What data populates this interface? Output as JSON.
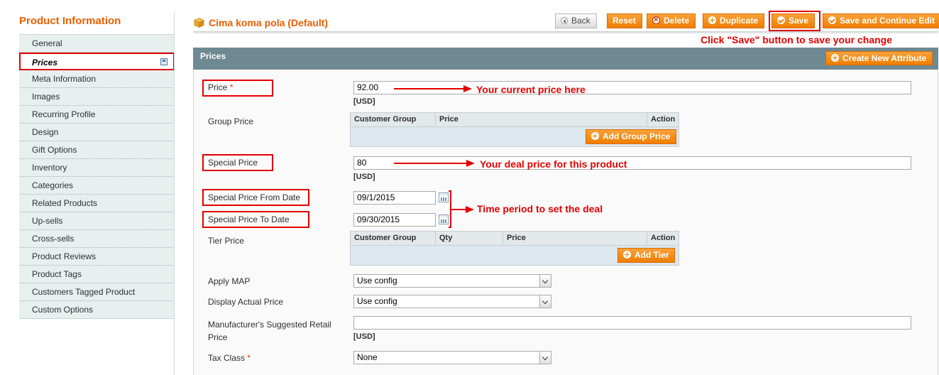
{
  "sidebar": {
    "title": "Product Information",
    "items": [
      {
        "label": "General"
      },
      {
        "label": "Prices"
      },
      {
        "label": "Meta Information"
      },
      {
        "label": "Images"
      },
      {
        "label": "Recurring Profile"
      },
      {
        "label": "Design"
      },
      {
        "label": "Gift Options"
      },
      {
        "label": "Inventory"
      },
      {
        "label": "Categories"
      },
      {
        "label": "Related Products"
      },
      {
        "label": "Up-sells"
      },
      {
        "label": "Cross-sells"
      },
      {
        "label": "Product Reviews"
      },
      {
        "label": "Product Tags"
      },
      {
        "label": "Customers Tagged Product"
      },
      {
        "label": "Custom Options"
      }
    ]
  },
  "header": {
    "title": "Cima koma pola (Default)",
    "buttons": {
      "back": "Back",
      "reset": "Reset",
      "delete": "Delete",
      "duplicate": "Duplicate",
      "save": "Save",
      "save_continue": "Save and Continue Edit"
    }
  },
  "annotations": {
    "save_hint": "Click \"Save\" button to save your change",
    "price_hint": "Your current price here",
    "special_hint": "Your deal price for this product",
    "period_hint": "Time period to set the deal"
  },
  "section": {
    "title": "Prices",
    "create_attribute": "Create New Attribute"
  },
  "form": {
    "price": {
      "label": "Price",
      "required": "*",
      "value": "92.00",
      "unit": "[USD]"
    },
    "group_price": {
      "label": "Group Price",
      "columns": [
        "Customer Group",
        "Price",
        "Action"
      ],
      "add_button": "Add Group Price"
    },
    "special_price": {
      "label": "Special Price",
      "value": "80",
      "unit": "[USD]"
    },
    "special_from": {
      "label": "Special Price From Date",
      "value": "09/1/2015"
    },
    "special_to": {
      "label": "Special Price To Date",
      "value": "09/30/2015"
    },
    "tier_price": {
      "label": "Tier Price",
      "columns": [
        "Customer Group",
        "Qty",
        "Price",
        "Action"
      ],
      "add_button": "Add Tier"
    },
    "apply_map": {
      "label": "Apply MAP",
      "value": "Use config"
    },
    "display_actual_price": {
      "label": "Display Actual Price",
      "value": "Use config"
    },
    "msrp": {
      "label_line1": "Manufacturer's Suggested Retail",
      "label_line2": "Price",
      "value": "",
      "unit": "[USD]"
    },
    "tax_class": {
      "label": "Tax Class",
      "required": "*",
      "value": "None"
    }
  },
  "colors": {
    "accent": "#eb5e00",
    "annotation": "#e30000",
    "section_bar": "#6f8992",
    "button": "#f07d00"
  },
  "icons": [
    "cube-icon",
    "save-icon",
    "back-icon",
    "delete-icon",
    "plus-icon",
    "check-icon",
    "calendar-icon",
    "dropdown-arrow-icon"
  ]
}
